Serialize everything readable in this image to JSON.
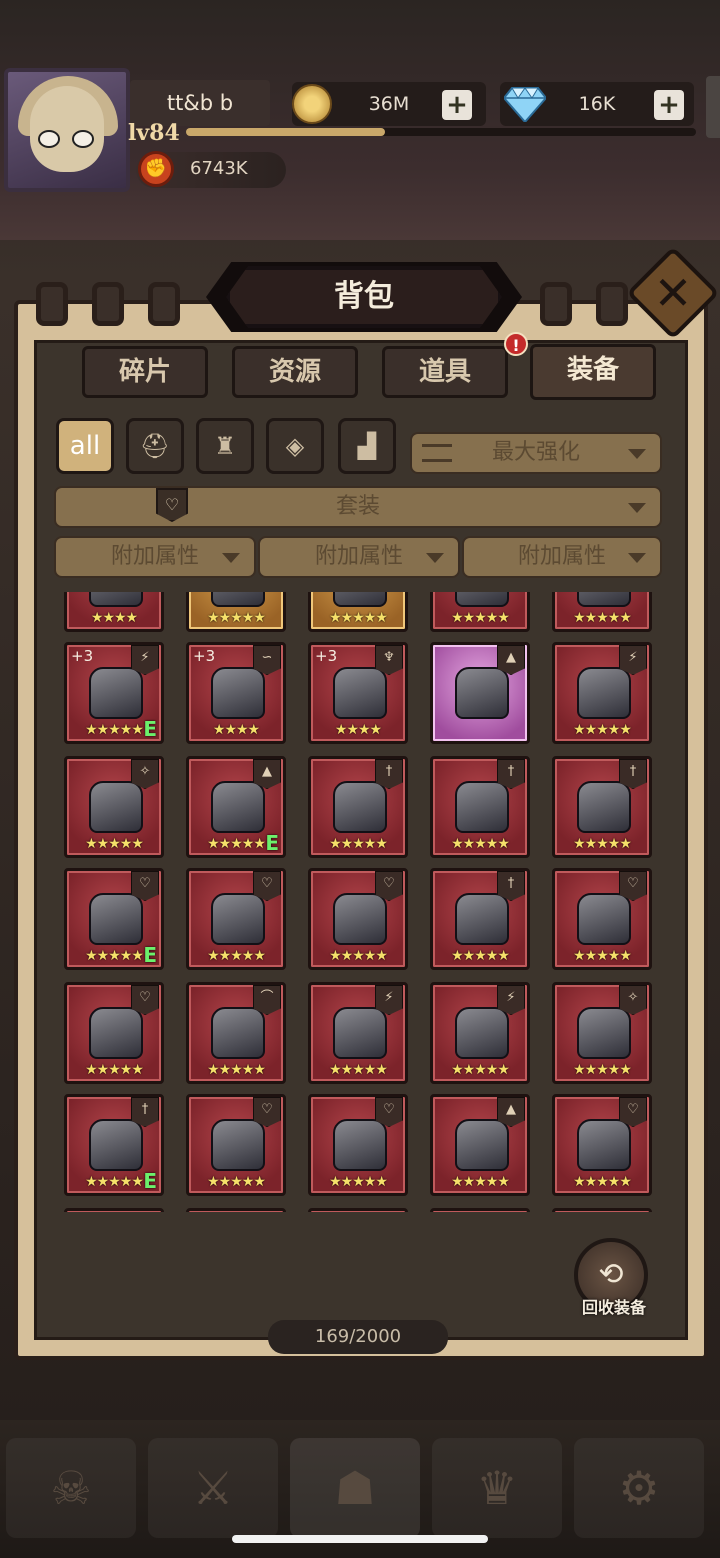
{
  "player": {
    "name": "tt&b b",
    "level": "lv84",
    "power": "6743K",
    "xp_progress": 0.39
  },
  "currency": {
    "gold": "36M",
    "gems": "16K",
    "plus": "+"
  },
  "panel": {
    "title": "背包",
    "close": "✕"
  },
  "tabs": [
    {
      "label": "碎片"
    },
    {
      "label": "资源"
    },
    {
      "label": "道具"
    },
    {
      "label": "装备"
    }
  ],
  "alert_badge": "!",
  "filters": {
    "all": "all"
  },
  "sort": {
    "label": "最大强化"
  },
  "set_filter": {
    "label": "套装"
  },
  "attribute_filters": [
    "附加属性",
    "附加属性",
    "附加属性"
  ],
  "items": [
    {
      "stars": "★★★★",
      "plus": "",
      "tag": "",
      "e": ""
    },
    {
      "stars": "★★★★★",
      "plus": "",
      "tag": "",
      "e": ""
    },
    {
      "stars": "★★★★★",
      "plus": "",
      "tag": "",
      "e": ""
    },
    {
      "stars": "★★★★★",
      "plus": "",
      "tag": "",
      "e": ""
    },
    {
      "stars": "★★★★★",
      "plus": "",
      "tag": "",
      "e": ""
    },
    {
      "stars": "★★★★★",
      "plus": "+3",
      "tag": "⚡",
      "e": "E"
    },
    {
      "stars": "★★★★",
      "plus": "+3",
      "tag": "∽",
      "e": ""
    },
    {
      "stars": "★★★★",
      "plus": "+3",
      "tag": "♆",
      "e": ""
    },
    {
      "stars": "",
      "plus": "",
      "tag": "▲",
      "e": ""
    },
    {
      "stars": "★★★★★",
      "plus": "",
      "tag": "⚡",
      "e": ""
    },
    {
      "stars": "★★★★★",
      "plus": "",
      "tag": "✧",
      "e": ""
    },
    {
      "stars": "★★★★★",
      "plus": "",
      "tag": "▲",
      "e": "E"
    },
    {
      "stars": "★★★★★",
      "plus": "",
      "tag": "†",
      "e": ""
    },
    {
      "stars": "★★★★★",
      "plus": "",
      "tag": "†",
      "e": ""
    },
    {
      "stars": "★★★★★",
      "plus": "",
      "tag": "†",
      "e": ""
    },
    {
      "stars": "★★★★★",
      "plus": "",
      "tag": "♡",
      "e": "E"
    },
    {
      "stars": "★★★★★",
      "plus": "",
      "tag": "♡",
      "e": ""
    },
    {
      "stars": "★★★★★",
      "plus": "",
      "tag": "♡",
      "e": ""
    },
    {
      "stars": "★★★★★",
      "plus": "",
      "tag": "†",
      "e": ""
    },
    {
      "stars": "★★★★★",
      "plus": "",
      "tag": "♡",
      "e": ""
    },
    {
      "stars": "★★★★★",
      "plus": "",
      "tag": "♡",
      "e": ""
    },
    {
      "stars": "★★★★★",
      "plus": "",
      "tag": "⌒",
      "e": ""
    },
    {
      "stars": "★★★★★",
      "plus": "",
      "tag": "⚡",
      "e": ""
    },
    {
      "stars": "★★★★★",
      "plus": "",
      "tag": "⚡",
      "e": ""
    },
    {
      "stars": "★★★★★",
      "plus": "",
      "tag": "✧",
      "e": ""
    },
    {
      "stars": "★★★★★",
      "plus": "",
      "tag": "†",
      "e": "E"
    },
    {
      "stars": "★★★★★",
      "plus": "",
      "tag": "♡",
      "e": ""
    },
    {
      "stars": "★★★★★",
      "plus": "",
      "tag": "♡",
      "e": ""
    },
    {
      "stars": "★★★★★",
      "plus": "",
      "tag": "▲",
      "e": ""
    },
    {
      "stars": "★★★★★",
      "plus": "",
      "tag": "♡",
      "e": ""
    }
  ],
  "inventory_count": "169/2000",
  "recycle": {
    "label": "回收装备"
  },
  "colors": {
    "accent": "#d0b27c",
    "item_bg": "#7c232a",
    "star": "#f5e06a",
    "e_mark": "#6cf06c"
  }
}
